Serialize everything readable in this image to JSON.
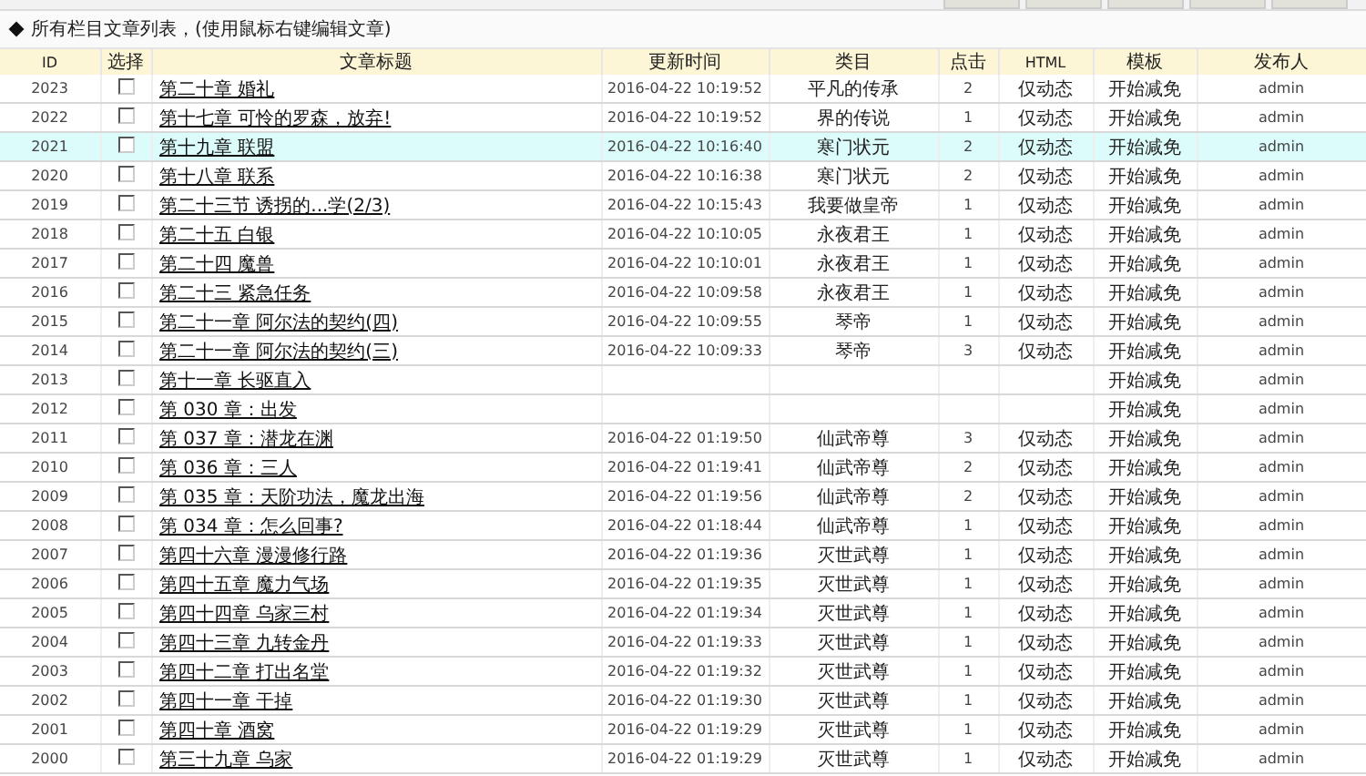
{
  "heading": "所有栏目文章列表，(使用鼠标右键编辑文章)",
  "table": {
    "columns": [
      "ID",
      "选择",
      "文章标题",
      "更新时间",
      "类目",
      "点击",
      "HTML",
      "模板",
      "发布人"
    ],
    "rows": [
      {
        "id": "2023",
        "checked": false,
        "selected": false,
        "title": "第二十章 婚礼",
        "time": "2016-04-22 10:19:52",
        "category": "平凡的传承",
        "hits": "2",
        "html": "仅动态",
        "template": "开始减免",
        "author": "admin"
      },
      {
        "id": "2022",
        "checked": false,
        "selected": false,
        "title": "第十七章 可怜的罗森，放弃!",
        "time": "2016-04-22 10:19:52",
        "category": "界的传说",
        "hits": "1",
        "html": "仅动态",
        "template": "开始减免",
        "author": "admin"
      },
      {
        "id": "2021",
        "checked": false,
        "selected": true,
        "title": "第十九章 联盟",
        "time": "2016-04-22 10:16:40",
        "category": "寒门状元",
        "hits": "2",
        "html": "仅动态",
        "template": "开始减免",
        "author": "admin"
      },
      {
        "id": "2020",
        "checked": false,
        "selected": false,
        "title": "第十八章 联系",
        "time": "2016-04-22 10:16:38",
        "category": "寒门状元",
        "hits": "2",
        "html": "仅动态",
        "template": "开始减免",
        "author": "admin"
      },
      {
        "id": "2019",
        "checked": false,
        "selected": false,
        "title": "第二十三节 诱拐的...学(2/3)",
        "time": "2016-04-22 10:15:43",
        "category": "我要做皇帝",
        "hits": "1",
        "html": "仅动态",
        "template": "开始减免",
        "author": "admin"
      },
      {
        "id": "2018",
        "checked": false,
        "selected": false,
        "title": "第二十五 白银",
        "time": "2016-04-22 10:10:05",
        "category": "永夜君王",
        "hits": "1",
        "html": "仅动态",
        "template": "开始减免",
        "author": "admin"
      },
      {
        "id": "2017",
        "checked": false,
        "selected": false,
        "title": "第二十四 魔兽",
        "time": "2016-04-22 10:10:01",
        "category": "永夜君王",
        "hits": "1",
        "html": "仅动态",
        "template": "开始减免",
        "author": "admin"
      },
      {
        "id": "2016",
        "checked": false,
        "selected": false,
        "title": "第二十三 紧急任务",
        "time": "2016-04-22 10:09:58",
        "category": "永夜君王",
        "hits": "1",
        "html": "仅动态",
        "template": "开始减免",
        "author": "admin"
      },
      {
        "id": "2015",
        "checked": false,
        "selected": false,
        "title": "第二十一章 阿尔法的契约(四)",
        "time": "2016-04-22 10:09:55",
        "category": "琴帝",
        "hits": "1",
        "html": "仅动态",
        "template": "开始减免",
        "author": "admin"
      },
      {
        "id": "2014",
        "checked": false,
        "selected": false,
        "title": "第二十一章 阿尔法的契约(三)",
        "time": "2016-04-22 10:09:33",
        "category": "琴帝",
        "hits": "3",
        "html": "仅动态",
        "template": "开始减免",
        "author": "admin"
      },
      {
        "id": "2013",
        "checked": false,
        "selected": false,
        "title": "第十一章 长驱直入",
        "template": "开始减免",
        "author": "admin"
      },
      {
        "id": "2012",
        "checked": false,
        "selected": false,
        "title": "第 030 章：出发",
        "template": "开始减免",
        "author": "admin"
      },
      {
        "id": "2011",
        "checked": false,
        "selected": false,
        "title": "第 037 章：潜龙在渊",
        "time": "2016-04-22 01:19:50",
        "category": "仙武帝尊",
        "hits": "3",
        "html": "仅动态",
        "template": "开始减免",
        "author": "admin"
      },
      {
        "id": "2010",
        "checked": false,
        "selected": false,
        "title": "第 036 章：三人",
        "time": "2016-04-22 01:19:41",
        "category": "仙武帝尊",
        "hits": "2",
        "html": "仅动态",
        "template": "开始减免",
        "author": "admin"
      },
      {
        "id": "2009",
        "checked": false,
        "selected": false,
        "title": "第 035 章：天阶功法，魔龙出海",
        "time": "2016-04-22 01:19:56",
        "category": "仙武帝尊",
        "hits": "2",
        "html": "仅动态",
        "template": "开始减免",
        "author": "admin"
      },
      {
        "id": "2008",
        "checked": false,
        "selected": false,
        "title": "第 034 章：怎么回事?",
        "time": "2016-04-22 01:18:44",
        "category": "仙武帝尊",
        "hits": "1",
        "html": "仅动态",
        "template": "开始减免",
        "author": "admin"
      },
      {
        "id": "2007",
        "checked": false,
        "selected": false,
        "title": "第四十六章 漫漫修行路",
        "time": "2016-04-22 01:19:36",
        "category": "灭世武尊",
        "hits": "1",
        "html": "仅动态",
        "template": "开始减免",
        "author": "admin"
      },
      {
        "id": "2006",
        "checked": false,
        "selected": false,
        "title": "第四十五章 魔力气场",
        "time": "2016-04-22 01:19:35",
        "category": "灭世武尊",
        "hits": "1",
        "html": "仅动态",
        "template": "开始减免",
        "author": "admin"
      },
      {
        "id": "2005",
        "checked": false,
        "selected": false,
        "title": "第四十四章 乌家三村",
        "time": "2016-04-22 01:19:34",
        "category": "灭世武尊",
        "hits": "1",
        "html": "仅动态",
        "template": "开始减免",
        "author": "admin"
      },
      {
        "id": "2004",
        "checked": false,
        "selected": false,
        "title": "第四十三章 九转金丹",
        "time": "2016-04-22 01:19:33",
        "category": "灭世武尊",
        "hits": "1",
        "html": "仅动态",
        "template": "开始减免",
        "author": "admin"
      },
      {
        "id": "2003",
        "checked": false,
        "selected": false,
        "title": "第四十二章 打出名堂",
        "time": "2016-04-22 01:19:32",
        "category": "灭世武尊",
        "hits": "1",
        "html": "仅动态",
        "template": "开始减免",
        "author": "admin"
      },
      {
        "id": "2002",
        "checked": false,
        "selected": false,
        "title": "第四十一章 干掉",
        "time": "2016-04-22 01:19:30",
        "category": "灭世武尊",
        "hits": "1",
        "html": "仅动态",
        "template": "开始减免",
        "author": "admin"
      },
      {
        "id": "2001",
        "checked": false,
        "selected": false,
        "title": "第四十章 酒窝",
        "time": "2016-04-22 01:19:29",
        "category": "灭世武尊",
        "hits": "1",
        "html": "仅动态",
        "template": "开始减免",
        "author": "admin"
      },
      {
        "id": "2000",
        "checked": false,
        "selected": false,
        "title": "第三十九章 乌家",
        "time": "2016-04-22 01:19:29",
        "category": "灭世武尊",
        "hits": "1",
        "html": "仅动态",
        "template": "开始减免",
        "author": "admin"
      }
    ]
  }
}
